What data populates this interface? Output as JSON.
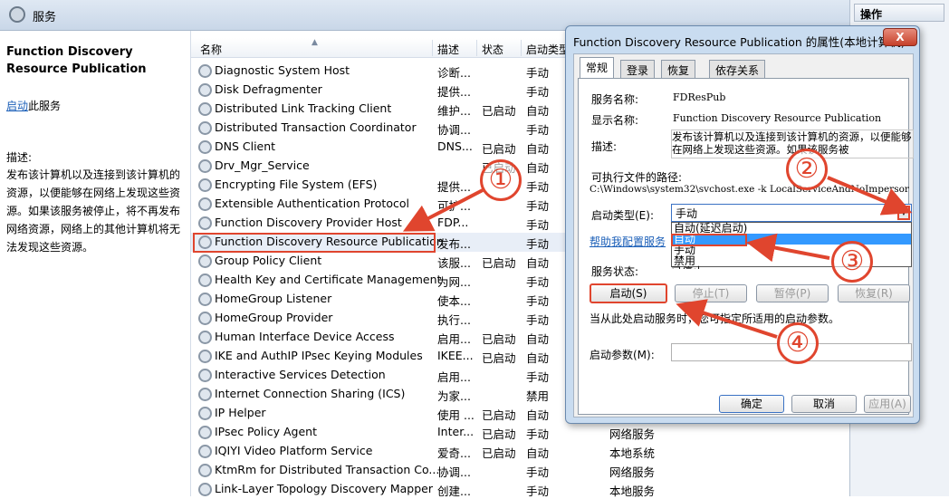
{
  "window": {
    "title": "服务"
  },
  "actions_pane": {
    "header": "操作"
  },
  "left_pane": {
    "service_title": "Function Discovery Resource Publication",
    "start_link": "启动",
    "start_suffix": "此服务",
    "desc_label": "描述:",
    "desc_text": "发布该计算机以及连接到该计算机的资源，以便能够在网络上发现这些资源。如果该服务被停止，将不再发布网络资源，网络上的其他计算机将无法发现这些资源。"
  },
  "list": {
    "headers": [
      "名称",
      "描述",
      "状态",
      "启动类型"
    ],
    "rows": [
      {
        "name": "Diagnostic System Host",
        "desc": "诊断...",
        "status": "",
        "startup": "手动",
        "logon": ""
      },
      {
        "name": "Disk Defragmenter",
        "desc": "提供...",
        "status": "",
        "startup": "手动",
        "logon": ""
      },
      {
        "name": "Distributed Link Tracking Client",
        "desc": "维护...",
        "status": "已启动",
        "startup": "自动",
        "logon": ""
      },
      {
        "name": "Distributed Transaction Coordinator",
        "desc": "协调...",
        "status": "",
        "startup": "手动",
        "logon": ""
      },
      {
        "name": "DNS Client",
        "desc": "DNS...",
        "status": "已启动",
        "startup": "自动",
        "logon": ""
      },
      {
        "name": "Drv_Mgr_Service",
        "desc": "",
        "status": "已启动",
        "startup": "自动",
        "logon": ""
      },
      {
        "name": "Encrypting File System (EFS)",
        "desc": "提供...",
        "status": "",
        "startup": "手动",
        "logon": ""
      },
      {
        "name": "Extensible Authentication Protocol",
        "desc": "可扩...",
        "status": "",
        "startup": "手动",
        "logon": ""
      },
      {
        "name": "Function Discovery Provider Host",
        "desc": "FDP...",
        "status": "",
        "startup": "手动",
        "logon": ""
      },
      {
        "name": "Function Discovery Resource Publication",
        "desc": "发布...",
        "status": "",
        "startup": "手动",
        "logon": ""
      },
      {
        "name": "Group Policy Client",
        "desc": "该服...",
        "status": "已启动",
        "startup": "自动",
        "logon": ""
      },
      {
        "name": "Health Key and Certificate Management",
        "desc": "为网...",
        "status": "",
        "startup": "手动",
        "logon": ""
      },
      {
        "name": "HomeGroup Listener",
        "desc": "使本...",
        "status": "",
        "startup": "手动",
        "logon": ""
      },
      {
        "name": "HomeGroup Provider",
        "desc": "执行...",
        "status": "",
        "startup": "手动",
        "logon": ""
      },
      {
        "name": "Human Interface Device Access",
        "desc": "启用...",
        "status": "已启动",
        "startup": "自动",
        "logon": ""
      },
      {
        "name": "IKE and AuthIP IPsec Keying Modules",
        "desc": "IKEE...",
        "status": "已启动",
        "startup": "自动",
        "logon": ""
      },
      {
        "name": "Interactive Services Detection",
        "desc": "启用...",
        "status": "",
        "startup": "手动",
        "logon": ""
      },
      {
        "name": "Internet Connection Sharing (ICS)",
        "desc": "为家...",
        "status": "",
        "startup": "禁用",
        "logon": ""
      },
      {
        "name": "IP Helper",
        "desc": "使用 ...",
        "status": "已启动",
        "startup": "自动",
        "logon": ""
      },
      {
        "name": "IPsec Policy Agent",
        "desc": "Inter...",
        "status": "已启动",
        "startup": "手动",
        "logon": "网络服务"
      },
      {
        "name": "IQIYI Video Platform Service",
        "desc": "爱奇...",
        "status": "已启动",
        "startup": "自动",
        "logon": "本地系统"
      },
      {
        "name": "KtmRm for Distributed Transaction Co...",
        "desc": "协调...",
        "status": "",
        "startup": "手动",
        "logon": "网络服务"
      },
      {
        "name": "Link-Layer Topology Discovery Mapper",
        "desc": "创建...",
        "status": "",
        "startup": "手动",
        "logon": "本地服务"
      }
    ]
  },
  "dialog": {
    "title": "Function Discovery Resource Publication 的属性(本地计算机)",
    "close": "X",
    "tabs": [
      "常规",
      "登录",
      "恢复",
      "依存关系"
    ],
    "service_name_label": "服务名称:",
    "service_name": "FDResPub",
    "display_name_label": "显示名称:",
    "display_name": "Function Discovery Resource Publication",
    "desc_label": "描述:",
    "desc_text": "发布该计算机以及连接到该计算机的资源，以便能够在网络上发现这些资源。如果该服务被",
    "path_label": "可执行文件的路径:",
    "path_value": "C:\\Windows\\system32\\svchost.exe -k LocalServiceAndNoImpersor",
    "startup_type_label": "启动类型(E):",
    "startup_type_value": "手动",
    "startup_options": [
      "自动(延迟启动)",
      "自动",
      "手动",
      "禁用"
    ],
    "help_link": "帮助我配置服务",
    "status_label": "服务状态:",
    "status_value": "已停止",
    "buttons": {
      "start": "启动(S)",
      "stop": "停止(T)",
      "pause": "暂停(P)",
      "resume": "恢复(R)"
    },
    "hint": "当从此处启动服务时，您可指定所适用的启动参数。",
    "params_label": "启动参数(M):",
    "ok": "确定",
    "cancel": "取消",
    "apply": "应用(A)"
  },
  "callouts": [
    "①",
    "②",
    "③",
    "④"
  ],
  "colors": {
    "annotation": "#e0452e",
    "selection": "#3399ff"
  }
}
